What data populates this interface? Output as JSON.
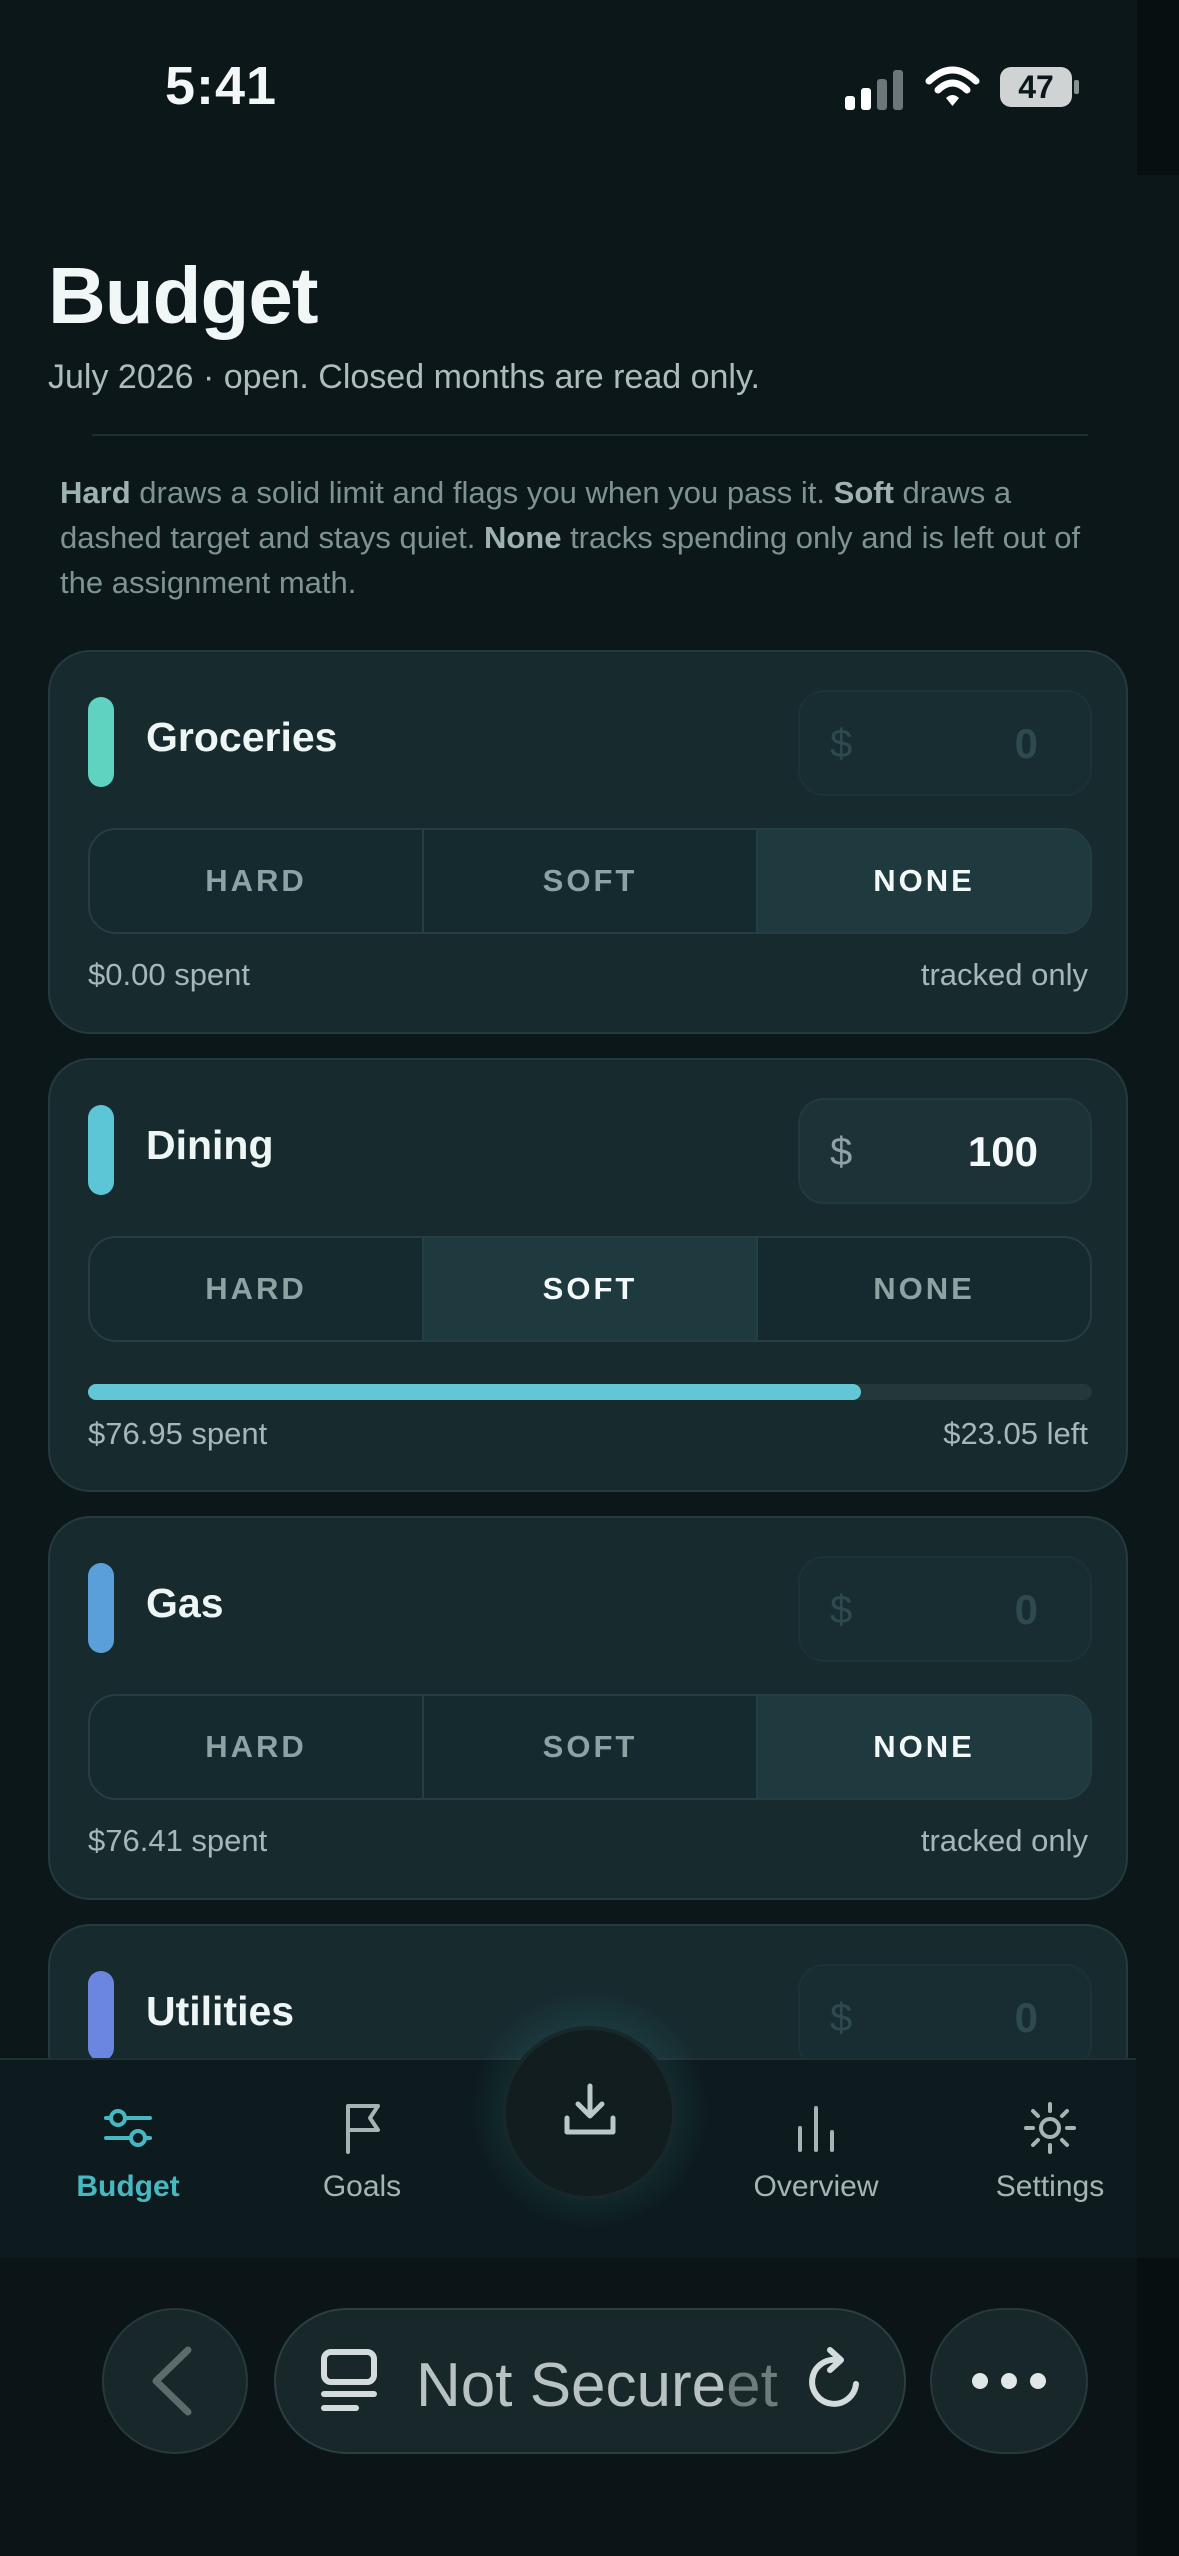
{
  "status": {
    "time": "5:41",
    "battery": "47"
  },
  "page": {
    "title": "Budget",
    "subtitle": "July 2026 · open. Closed months are read only.",
    "explainer": {
      "hard_word": "Hard",
      "hard_text": " draws a solid limit and flags you when you pass it. ",
      "soft_word": "Soft",
      "soft_text": " draws a dashed target and stays quiet. ",
      "none_word": "None",
      "none_text": " tracks spending only and is left out of the assignment math."
    }
  },
  "categories": [
    {
      "name": "Groceries",
      "color": "#5fd3c0",
      "currency": "$",
      "amount": "0",
      "amount_dim": true,
      "modes": [
        "HARD",
        "SOFT",
        "NONE"
      ],
      "selected_mode": "NONE",
      "spent": "$0.00 spent",
      "right_note": "tracked only"
    },
    {
      "name": "Dining",
      "color": "#5cc6d6",
      "currency": "$",
      "amount": "100",
      "amount_dim": false,
      "modes": [
        "HARD",
        "SOFT",
        "NONE"
      ],
      "selected_mode": "SOFT",
      "spent": "$76.95 spent",
      "right_note": "$23.05 left",
      "progress": 0.7695
    },
    {
      "name": "Gas",
      "color": "#5b9fd8",
      "currency": "$",
      "amount": "0",
      "amount_dim": true,
      "modes": [
        "HARD",
        "SOFT",
        "NONE"
      ],
      "selected_mode": "NONE",
      "spent": "$76.41 spent",
      "right_note": "tracked only"
    },
    {
      "name": "Utilities",
      "color": "#6a86e0",
      "currency": "$",
      "amount": "0",
      "amount_dim": true
    }
  ],
  "tabbar": {
    "items": [
      {
        "label": "Budget",
        "icon": "sliders-icon",
        "active": true
      },
      {
        "label": "Goals",
        "icon": "flag-icon",
        "active": false
      },
      {
        "label": "Overview",
        "icon": "bar-chart-icon",
        "active": false
      },
      {
        "label": "Settings",
        "icon": "gear-icon",
        "active": false
      }
    ],
    "fab_icon": "download-icon",
    "accent": "#47b8c2"
  },
  "browser": {
    "url_text": "Not Secure",
    "url_ghost": "et"
  }
}
